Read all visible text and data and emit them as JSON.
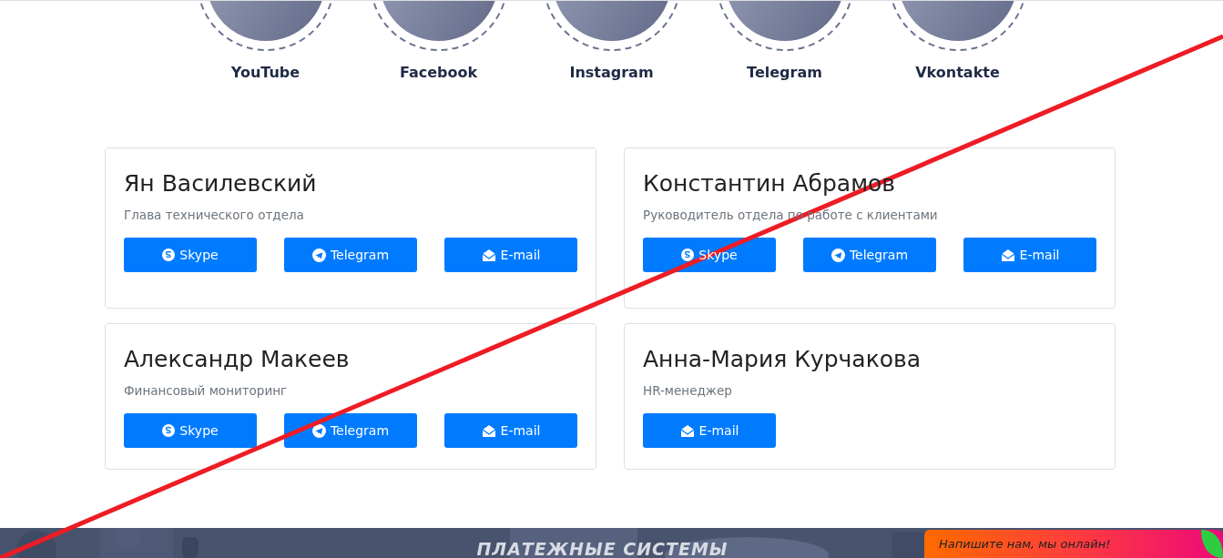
{
  "socials": [
    {
      "label": "YouTube"
    },
    {
      "label": "Facebook"
    },
    {
      "label": "Instagram"
    },
    {
      "label": "Telegram"
    },
    {
      "label": "Vkontakte"
    }
  ],
  "contacts": [
    {
      "name": "Ян Василевский",
      "role": "Глава технического отдела",
      "buttons": [
        {
          "kind": "skype",
          "label": "Skype"
        },
        {
          "kind": "telegram",
          "label": "Telegram"
        },
        {
          "kind": "email",
          "label": "E-mail"
        }
      ]
    },
    {
      "name": "Константин Абрамов",
      "role": "Руководитель отдела по работе с клиентами",
      "buttons": [
        {
          "kind": "skype",
          "label": "Skype"
        },
        {
          "kind": "telegram",
          "label": "Telegram"
        },
        {
          "kind": "email",
          "label": "E-mail"
        }
      ]
    },
    {
      "name": "Александр Макеев",
      "role": "Финансовый мониторинг",
      "buttons": [
        {
          "kind": "skype",
          "label": "Skype"
        },
        {
          "kind": "telegram",
          "label": "Telegram"
        },
        {
          "kind": "email",
          "label": "E-mail"
        }
      ]
    },
    {
      "name": "Анна-Мария Курчакова",
      "role": "HR-менеджер",
      "buttons": [
        {
          "kind": "email",
          "label": "E-mail"
        }
      ]
    }
  ],
  "section": {
    "title": "ПЛАТЕЖНЫЕ СИСТЕМЫ"
  },
  "chat": {
    "text": "Напишите нам, мы онлайн!"
  }
}
